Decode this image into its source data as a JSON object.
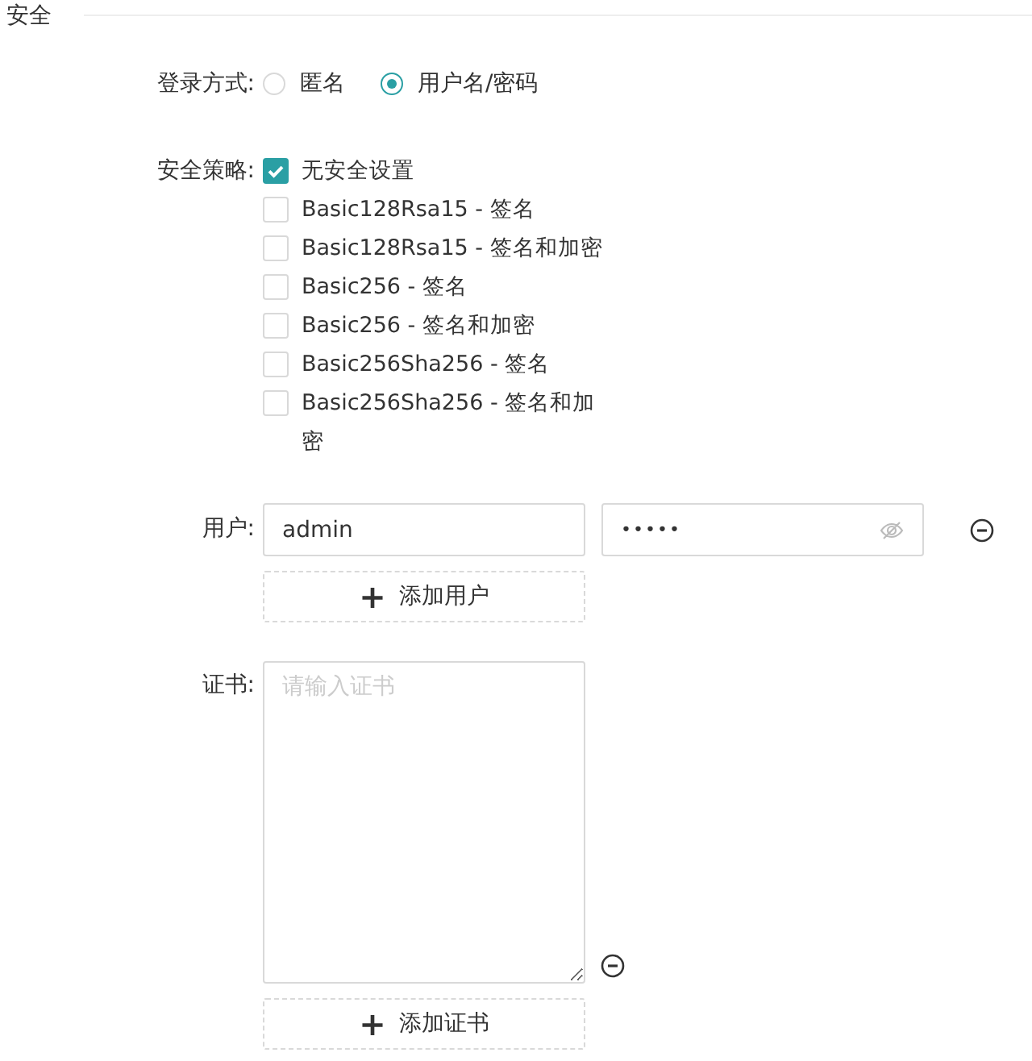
{
  "section": {
    "title": "安全"
  },
  "login_mode": {
    "label": "登录方式:",
    "options": [
      {
        "label": "匿名",
        "selected": false
      },
      {
        "label": "用户名/密码",
        "selected": true
      }
    ]
  },
  "security_policy": {
    "label": "安全策略:",
    "options": [
      {
        "label": "无安全设置",
        "checked": true
      },
      {
        "label": "Basic128Rsa15 - 签名",
        "checked": false
      },
      {
        "label": "Basic128Rsa15 - 签名和加密",
        "checked": false
      },
      {
        "label": "Basic256 - 签名",
        "checked": false
      },
      {
        "label": "Basic256 - 签名和加密",
        "checked": false
      },
      {
        "label": "Basic256Sha256 - 签名",
        "checked": false
      },
      {
        "label": "Basic256Sha256 - 签名和加密",
        "checked": false
      }
    ]
  },
  "users": {
    "label": "用户:",
    "rows": [
      {
        "username": "admin",
        "password": "•••••"
      }
    ],
    "add_button": {
      "icon": "+",
      "label": "添加用户"
    }
  },
  "certificates": {
    "label": "证书:",
    "fields": [
      {
        "placeholder": "请输入证书"
      }
    ],
    "add_button": {
      "icon": "+",
      "label": "添加证书"
    }
  }
}
